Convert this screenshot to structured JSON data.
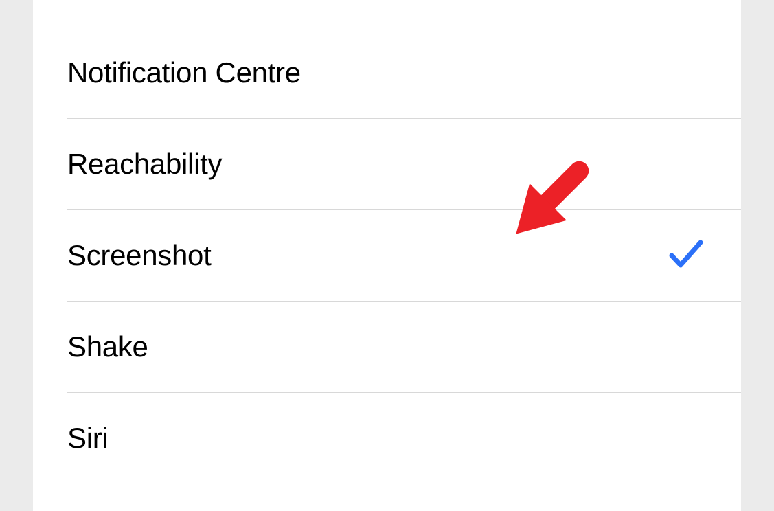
{
  "settings": {
    "items": [
      {
        "label": "",
        "selected": false
      },
      {
        "label": "Notification Centre",
        "selected": false
      },
      {
        "label": "Reachability",
        "selected": false
      },
      {
        "label": "Screenshot",
        "selected": true
      },
      {
        "label": "Shake",
        "selected": false
      },
      {
        "label": "Siri",
        "selected": false
      }
    ]
  },
  "colors": {
    "accent": "#2b70f8",
    "annotation": "#ec2127",
    "background": "#ebebeb",
    "divider": "#d8d8d8"
  }
}
